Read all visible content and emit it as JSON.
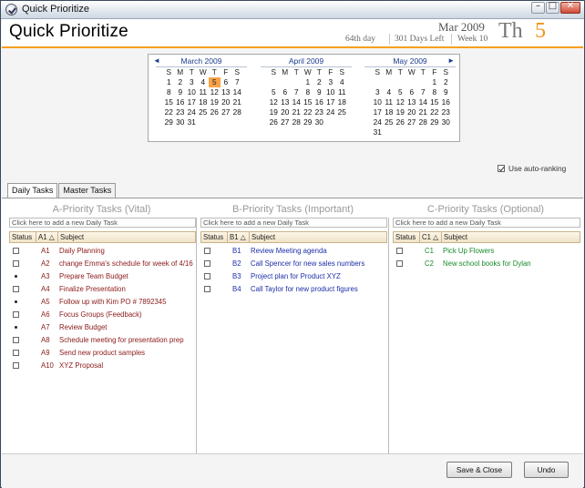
{
  "window": {
    "title": "Quick Prioritize",
    "buttons": [
      "–",
      "□",
      "✕"
    ]
  },
  "header": {
    "app_title": "Quick Prioritize",
    "month_year": "Mar 2009",
    "day_of_year": "64th day",
    "days_left": "301 Days Left",
    "week": "Week 10",
    "day_of_week": "Th",
    "day_number": "5"
  },
  "calendar": {
    "nav_prev": "◄",
    "nav_next": "►",
    "dow": [
      "S",
      "M",
      "T",
      "W",
      "T",
      "F",
      "S"
    ],
    "months": [
      {
        "name": "March 2009",
        "offset": 0,
        "days": 31,
        "today": 5
      },
      {
        "name": "April 2009",
        "offset": 3,
        "days": 30,
        "today": null
      },
      {
        "name": "May 2009",
        "offset": 5,
        "days": 31,
        "today": null
      }
    ]
  },
  "auto_ranking": {
    "label": "Use auto-ranking",
    "checked": true
  },
  "tabs": [
    {
      "label": "Daily Tasks",
      "active": true
    },
    {
      "label": "Master Tasks",
      "active": false
    }
  ],
  "priorities": [
    {
      "key": "a",
      "title": "A-Priority Tasks (Vital)",
      "add_placeholder": "Click here to add a new Daily Task",
      "headers": [
        "Status",
        "A1 △",
        "Subject"
      ],
      "tasks": [
        {
          "status": "checkbox",
          "priority": "A1",
          "subject": "Daily Planning"
        },
        {
          "status": "checkbox",
          "priority": "A2",
          "subject": "change Emma's schedule for week of 4/16"
        },
        {
          "status": "bullet",
          "priority": "A3",
          "subject": "Prepare Team Budget"
        },
        {
          "status": "checkbox",
          "priority": "A4",
          "subject": "Finalize Presentation"
        },
        {
          "status": "bullet",
          "priority": "A5",
          "subject": "Follow up with Kim PO # 7892345"
        },
        {
          "status": "checkbox",
          "priority": "A6",
          "subject": "Focus Groups (Feedback)"
        },
        {
          "status": "bullet",
          "priority": "A7",
          "subject": "Review Budget"
        },
        {
          "status": "checkbox",
          "priority": "A8",
          "subject": "Schedule meeting for presentation prep"
        },
        {
          "status": "checkbox",
          "priority": "A9",
          "subject": "Send new product samples"
        },
        {
          "status": "checkbox",
          "priority": "A10",
          "subject": "XYZ Proposal"
        }
      ]
    },
    {
      "key": "b",
      "title": "B-Priority Tasks (Important)",
      "add_placeholder": "Click here to add a new Daily Task",
      "headers": [
        "Status",
        "B1 △",
        "Subject"
      ],
      "tasks": [
        {
          "status": "checkbox",
          "priority": "B1",
          "subject": "Review Meeting agenda"
        },
        {
          "status": "checkbox",
          "priority": "B2",
          "subject": "Call Spencer for new sales numbers"
        },
        {
          "status": "checkbox",
          "priority": "B3",
          "subject": "Project plan for Product XYZ"
        },
        {
          "status": "checkbox",
          "priority": "B4",
          "subject": "Call Taylor for new product figures"
        }
      ]
    },
    {
      "key": "c",
      "title": "C-Priority Tasks (Optional)",
      "add_placeholder": "Click here to add a new Daily Task",
      "headers": [
        "Status",
        "C1 △",
        "Subject"
      ],
      "tasks": [
        {
          "status": "checkbox",
          "priority": "C1",
          "subject": "Pick Up Flowers"
        },
        {
          "status": "checkbox",
          "priority": "C2",
          "subject": "New school books for Dylan"
        }
      ]
    }
  ],
  "footer": {
    "save_close": "Save & Close",
    "undo": "Undo"
  }
}
